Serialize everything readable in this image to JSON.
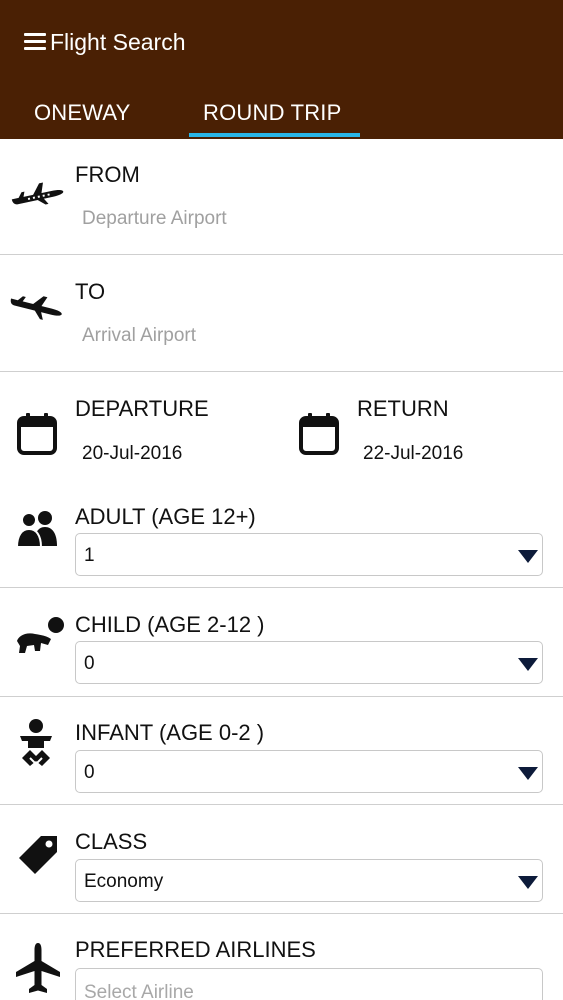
{
  "header": {
    "title": "Flight Search",
    "menu_icon": "hamburger-menu-icon",
    "background_color": "#4a2004",
    "tabs": [
      {
        "label": "ONEWAY",
        "selected": false
      },
      {
        "label": "ROUND TRIP",
        "selected": true
      }
    ],
    "tab_indicator_color": "#29b6e8"
  },
  "from": {
    "label": "FROM",
    "placeholder": "Departure Airport",
    "icon": "plane-takeoff-icon"
  },
  "to": {
    "label": "TO",
    "placeholder": "Arrival Airport",
    "icon": "plane-landing-icon"
  },
  "dates": {
    "departure": {
      "label": "DEPARTURE",
      "value": "20-Jul-2016",
      "icon": "calendar-icon"
    },
    "return": {
      "label": "RETURN",
      "value": "22-Jul-2016",
      "icon": "calendar-icon"
    }
  },
  "adult": {
    "label": "ADULT (AGE 12+)",
    "value": "1",
    "icon": "adults-icon"
  },
  "child": {
    "label": "CHILD (AGE 2-12 )",
    "value": "0",
    "icon": "child-icon"
  },
  "infant": {
    "label": "INFANT (AGE 0-2 )",
    "value": "0",
    "icon": "infant-icon"
  },
  "travel_class": {
    "label": "CLASS",
    "value": "Economy",
    "icon": "tag-icon"
  },
  "airlines": {
    "label": "PREFERRED AIRLINES",
    "placeholder": "Select Airline",
    "icon": "airplane-icon"
  }
}
